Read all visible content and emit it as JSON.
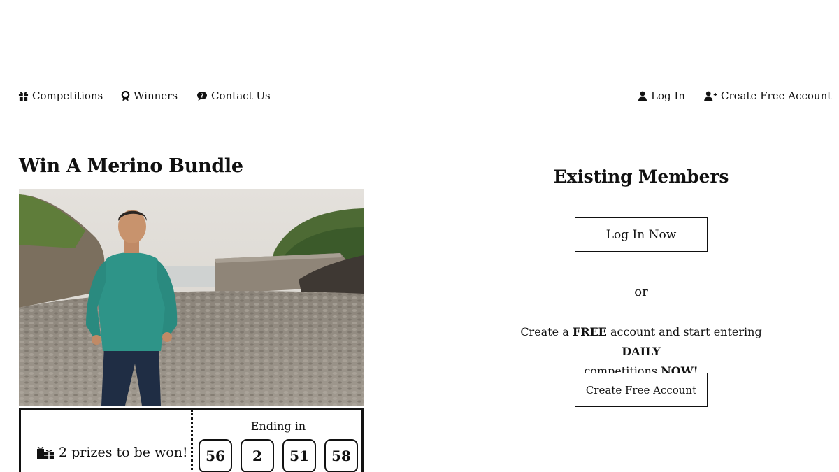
{
  "nav": {
    "left": [
      {
        "label": "Competitions",
        "icon": "gift-icon"
      },
      {
        "label": "Winners",
        "icon": "award-icon"
      },
      {
        "label": "Contact Us",
        "icon": "chat-icon"
      }
    ],
    "right": [
      {
        "label": "Log In",
        "icon": "user-icon"
      },
      {
        "label": "Create Free Account",
        "icon": "user-plus-icon"
      }
    ]
  },
  "competition": {
    "title": "Win A Merino Bundle",
    "prizes_text": "2 prizes to be won!",
    "ending_label": "Ending in",
    "countdown": [
      "56",
      "2",
      "51",
      "58"
    ]
  },
  "members": {
    "title": "Existing Members",
    "login_button": "Log In Now",
    "or_text": "or",
    "promo": {
      "part1": "Create a ",
      "bold1": "FREE",
      "part2": " account and start entering ",
      "bold2": "DAILY",
      "part3": " competitions ",
      "bold3": "NOW!"
    },
    "create_button": "Create Free Account"
  },
  "colors": {
    "text": "#111111",
    "divider": "#cfcfcf",
    "shirt": "#2e9488"
  }
}
